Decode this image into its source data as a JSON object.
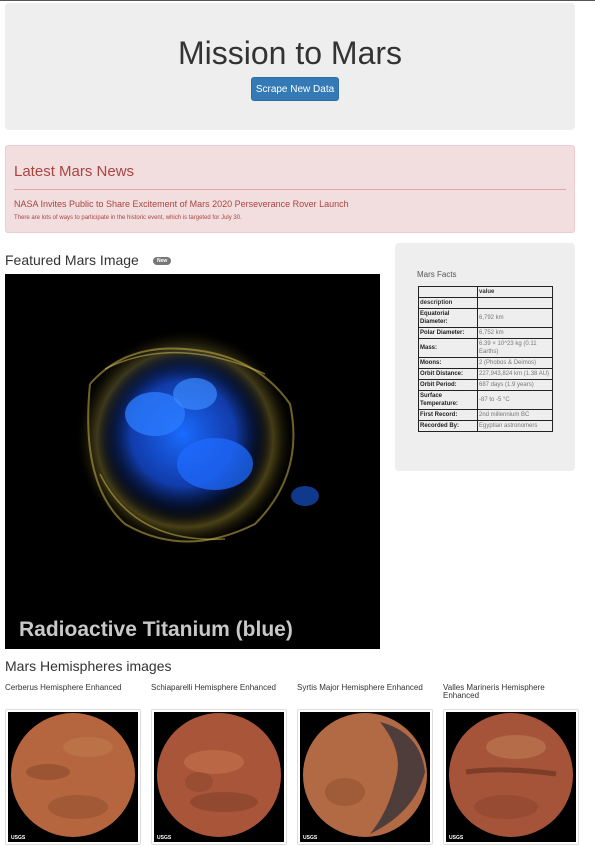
{
  "header": {
    "title": "Mission to Mars",
    "scrape_button": "Scrape New Data"
  },
  "news": {
    "heading": "Latest Mars News",
    "title": "NASA Invites Public to Share Excitement of Mars 2020 Perseverance Rover Launch",
    "teaser": "There are lots of ways to participate in the historic event, which is targeted for July 30."
  },
  "featured": {
    "heading": "Featured Mars Image",
    "badge": "New",
    "caption": "Radioactive Titanium (blue)"
  },
  "facts": {
    "heading": "Mars Facts",
    "column_header": "value",
    "index_label": "description",
    "rows": [
      {
        "label": "Equatorial Diameter:",
        "value": "6,792 km"
      },
      {
        "label": "Polar Diameter:",
        "value": "6,752 km"
      },
      {
        "label": "Mass:",
        "value": "6.39 × 10^23 kg (0.11 Earths)"
      },
      {
        "label": "Moons:",
        "value": "2 (Phobos & Deimos)"
      },
      {
        "label": "Orbit Distance:",
        "value": "227,943,824 km (1.38 AU)"
      },
      {
        "label": "Orbit Period:",
        "value": "687 days (1.9 years)"
      },
      {
        "label": "Surface Temperature:",
        "value": "-87 to -5 °C"
      },
      {
        "label": "First Record:",
        "value": "2nd millennium BC"
      },
      {
        "label": "Recorded By:",
        "value": "Egyptian astronomers"
      }
    ]
  },
  "hemispheres": {
    "heading": "Mars Hemispheres images",
    "items": [
      {
        "title": "Cerberus Hemisphere Enhanced",
        "logo": "USGS",
        "color": "#b5663e"
      },
      {
        "title": "Schiaparelli Hemisphere Enhanced",
        "logo": "USGS",
        "color": "#a9553a"
      },
      {
        "title": "Syrtis Major Hemisphere Enhanced",
        "logo": "USGS",
        "color": "#b26a44"
      },
      {
        "title": "Valles Marineris Hemisphere Enhanced",
        "logo": "USGS",
        "color": "#a5543a"
      }
    ]
  },
  "colors": {
    "jumbotron_bg": "#eeeeee",
    "button": "#337ab7",
    "alert_bg": "#f2dede",
    "alert_text": "#a94442"
  }
}
